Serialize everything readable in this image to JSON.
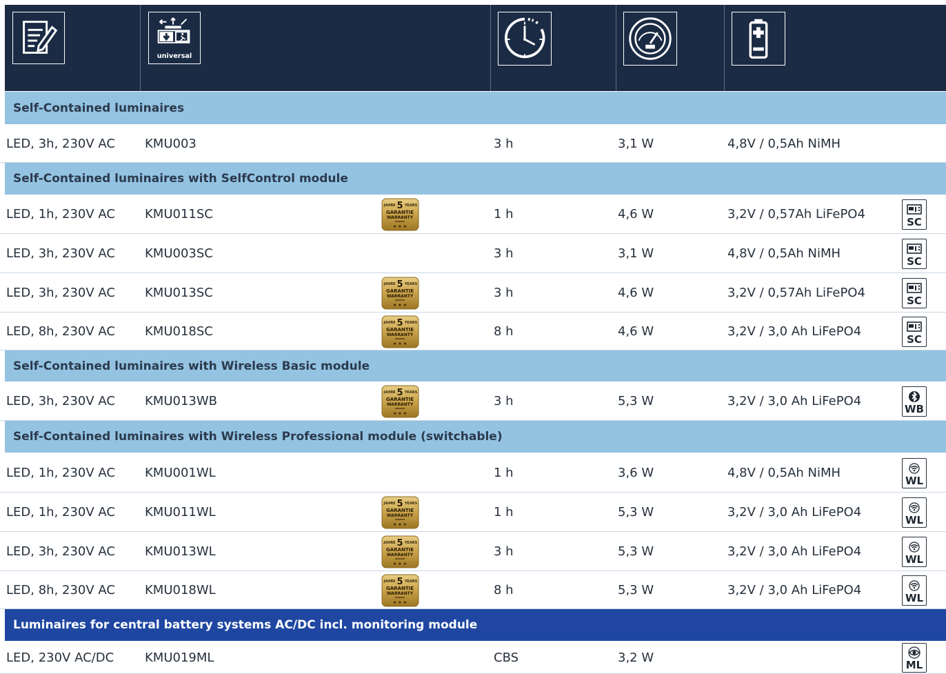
{
  "header": {
    "icons": [
      {
        "name": "document-pencil-icon"
      },
      {
        "name": "exit-sign-universal-icon",
        "label": "universal"
      },
      {
        "name": "clock-duration-icon"
      },
      {
        "name": "gauge-power-icon"
      },
      {
        "name": "battery-icon"
      }
    ]
  },
  "sections": [
    {
      "title": "Self-Contained luminaires"
    },
    {
      "title": "Self-Contained luminaires with SelfControl module"
    },
    {
      "title": "Self-Contained luminaires with Wireless Basic module"
    },
    {
      "title": "Self-Contained luminaires with Wireless Professional module (switchable)"
    },
    {
      "title": "Luminaires for central battery systems AC/DC incl. monitoring module"
    }
  ],
  "warranty_badge": {
    "line1": "JAHRE",
    "number": "5",
    "line1b": "YEARS",
    "line2": "GARANTIE",
    "line3": "WARRANTY"
  },
  "rows": [
    {
      "desc": "LED, 3h, 230V AC",
      "article": "KMU003",
      "duration": "3 h",
      "power": "3,1 W",
      "battery": "4,8V / 0,5Ah NiMH",
      "warranty": false,
      "module": ""
    },
    {
      "desc": "LED, 1h, 230V AC",
      "article": "KMU011SC",
      "duration": "1 h",
      "power": "4,6 W",
      "battery": "3,2V / 0,57Ah LiFePO4",
      "warranty": true,
      "module": "SC"
    },
    {
      "desc": "LED, 3h, 230V AC",
      "article": "KMU003SC",
      "duration": "3 h",
      "power": "3,1 W",
      "battery": "4,8V / 0,5Ah NiMH",
      "warranty": false,
      "module": "SC"
    },
    {
      "desc": "LED, 3h, 230V AC",
      "article": "KMU013SC",
      "duration": "3 h",
      "power": "4,6 W",
      "battery": "3,2V / 0,57Ah LiFePO4",
      "warranty": true,
      "module": "SC"
    },
    {
      "desc": "LED, 8h, 230V AC",
      "article": "KMU018SC",
      "duration": "8 h",
      "power": "4,6 W",
      "battery": "3,2V / 3,0 Ah LiFePO4",
      "warranty": true,
      "module": "SC"
    },
    {
      "desc": "LED, 3h, 230V AC",
      "article": "KMU013WB",
      "duration": "3 h",
      "power": "5,3 W",
      "battery": "3,2V / 3,0 Ah LiFePO4",
      "warranty": true,
      "module": "WB"
    },
    {
      "desc": "LED, 1h, 230V AC",
      "article": "KMU001WL",
      "duration": "1 h",
      "power": "3,6 W",
      "battery": "4,8V / 0,5Ah NiMH",
      "warranty": false,
      "module": "WL"
    },
    {
      "desc": "LED, 1h, 230V AC",
      "article": "KMU011WL",
      "duration": "1 h",
      "power": "5,3 W",
      "battery": "3,2V / 3,0 Ah LiFePO4",
      "warranty": true,
      "module": "WL"
    },
    {
      "desc": "LED, 3h, 230V AC",
      "article": "KMU013WL",
      "duration": "3 h",
      "power": "5,3 W",
      "battery": "3,2V / 3,0 Ah LiFePO4",
      "warranty": true,
      "module": "WL"
    },
    {
      "desc": "LED, 8h, 230V AC",
      "article": "KMU018WL",
      "duration": "8 h",
      "power": "5,3 W",
      "battery": "3,2V / 3,0 Ah LiFePO4",
      "warranty": true,
      "module": "WL"
    },
    {
      "desc": "LED, 230V AC/DC",
      "article": "KMU019ML",
      "duration": "CBS",
      "power": "3,2 W",
      "battery": "",
      "warranty": false,
      "module": "ML"
    }
  ],
  "colors": {
    "header": "#1b2b44",
    "section_light": "#94c3e2",
    "section_dark": "#1f47a2",
    "badge_gold": "#c9a24a"
  }
}
